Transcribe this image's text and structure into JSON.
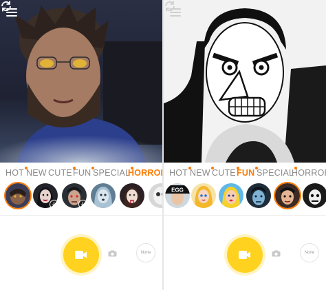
{
  "left_panel": {
    "tabs": [
      {
        "label": "HOT",
        "dot": true
      },
      {
        "label": "NEW",
        "dot": false
      },
      {
        "label": "CUTE",
        "dot": true
      },
      {
        "label": "FUN",
        "dot": true
      },
      {
        "label": "SPECIAL",
        "dot": true
      },
      {
        "label": "HORROR",
        "dot": true,
        "active": true
      }
    ],
    "none_label": "None"
  },
  "right_panel": {
    "tabs": [
      {
        "label": "HOT",
        "dot": true
      },
      {
        "label": "NEW",
        "dot": true
      },
      {
        "label": "CUTE",
        "dot": true
      },
      {
        "label": "FUN",
        "dot": true,
        "active": true
      },
      {
        "label": "SPECIAL",
        "dot": true
      },
      {
        "label": "HORROR",
        "dot": false
      }
    ],
    "egg_badge": "EGG",
    "none_label": "None"
  },
  "icons": [
    "menu-icon",
    "camera-switch-icon",
    "video-camera-icon",
    "photo-camera-icon",
    "download-icon"
  ],
  "colors": {
    "accent": "#ff7a00",
    "record": "#ffd21f",
    "inactive_tab": "#8a8a8a"
  }
}
